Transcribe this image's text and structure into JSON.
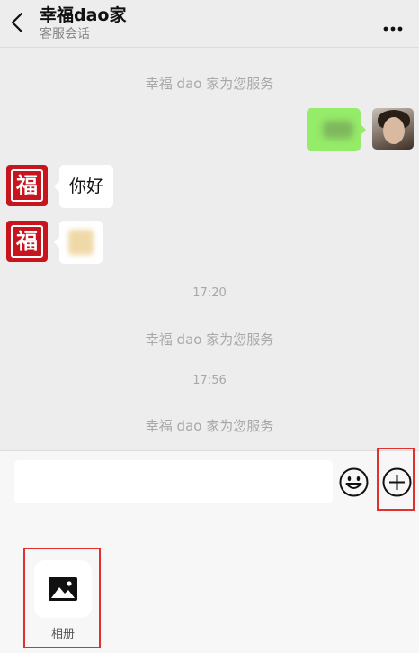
{
  "header": {
    "title": "幸福dao家",
    "subtitle": "客服会话",
    "back_icon": "chevron-left-icon",
    "more_icon": "more-dots-icon"
  },
  "messages": {
    "system_1": "幸福 dao 家为您服务",
    "greeting": "你好",
    "time_1": "17:20",
    "system_2": "幸福 dao 家为您服务",
    "time_2": "17:56",
    "system_3": "幸福 dao 家为您服务"
  },
  "avatar": {
    "agent_glyph": "福"
  },
  "inputbar": {
    "placeholder": "",
    "emoji_icon": "emoji-icon",
    "plus_icon": "plus-circle-icon"
  },
  "panel": {
    "items": [
      {
        "label": "相册",
        "icon": "image-icon"
      }
    ]
  },
  "colors": {
    "highlight": "#e03030",
    "sent_bubble": "#95ec69",
    "agent_avatar": "#c8151d"
  }
}
